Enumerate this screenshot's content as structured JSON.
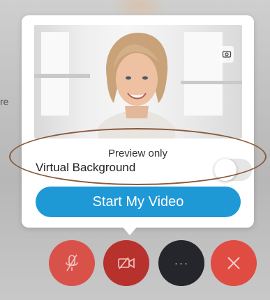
{
  "background": {
    "partial_text": "re"
  },
  "preview": {
    "label": "Preview only",
    "camera_switch_icon": "camera-switch-icon"
  },
  "virtual_background": {
    "label": "Virtual Background",
    "enabled": false
  },
  "start_button": {
    "label": "Start My Video"
  },
  "controls": {
    "mute_icon": "muted-microphone-icon",
    "video_icon": "video-off-icon",
    "more_label": "···",
    "leave_icon": "close-icon"
  },
  "colors": {
    "accent": "#1e99d6",
    "mute": "#d9524a",
    "video": "#b7322c",
    "more": "#25262b",
    "leave": "#e04c42",
    "highlight": "#8a5a3a"
  }
}
